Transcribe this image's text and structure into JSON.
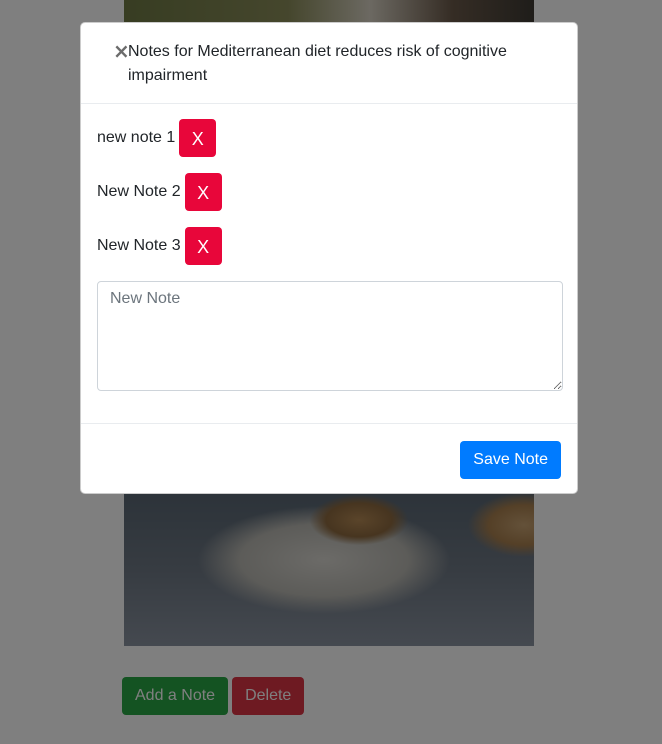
{
  "page": {
    "add_note_label": "Add a Note",
    "delete_label": "Delete"
  },
  "modal": {
    "close_symbol": "×",
    "title": "Notes for Mediterranean diet reduces risk of cognitive impairment",
    "notes": [
      {
        "text": "new note 1",
        "remove_label": "X"
      },
      {
        "text": "New Note 2",
        "remove_label": "X"
      },
      {
        "text": "New Note 3",
        "remove_label": "X"
      }
    ],
    "new_note_placeholder": "New Note",
    "new_note_value": "",
    "save_label": "Save Note"
  },
  "colors": {
    "primary": "#007bff",
    "success": "#28a745",
    "danger": "#dc3545",
    "remove": "#e8063a"
  }
}
